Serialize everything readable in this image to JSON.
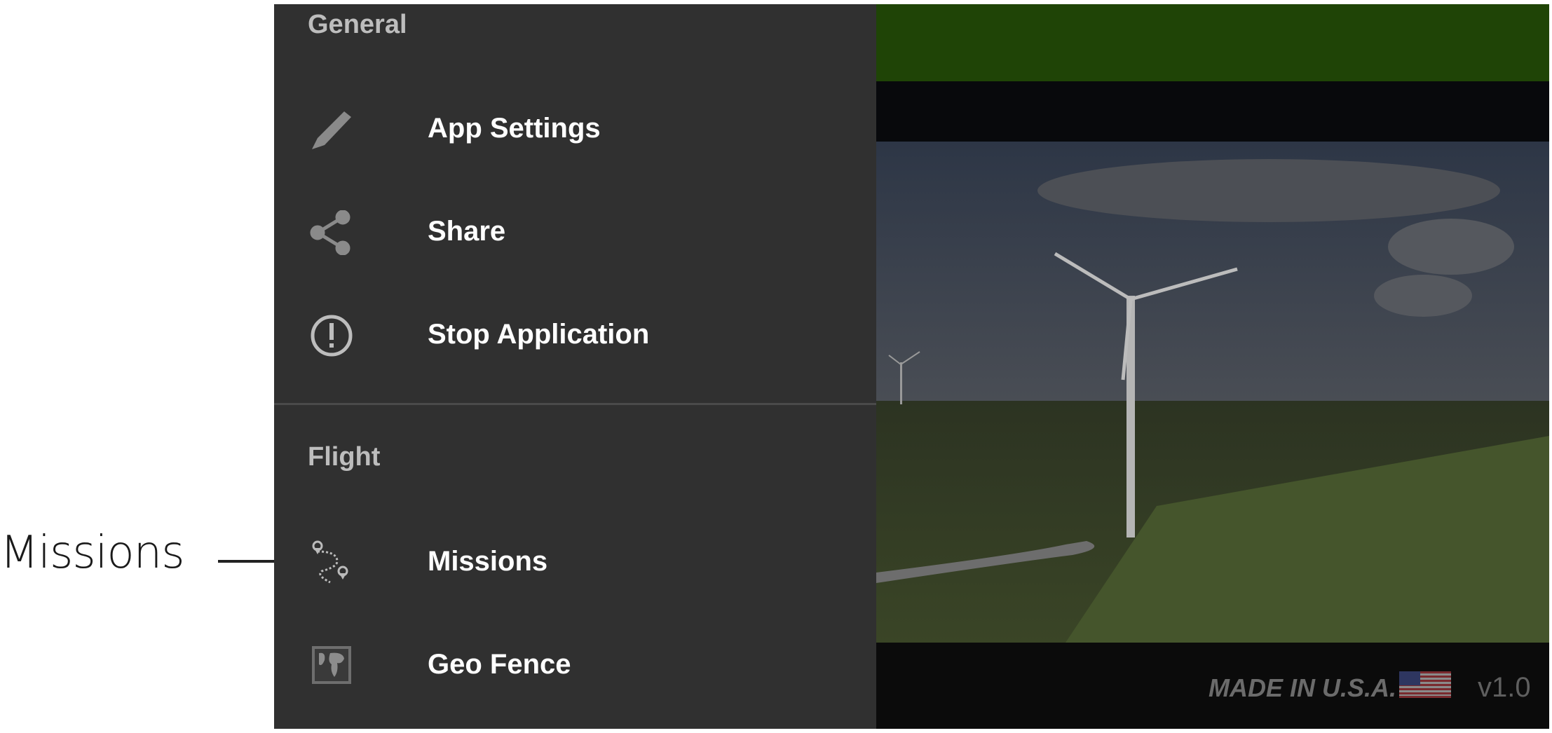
{
  "annotation": {
    "label": "Missions"
  },
  "drawer": {
    "sections": [
      {
        "title": "General",
        "items": [
          {
            "label": "App Settings",
            "icon": "pencil-icon"
          },
          {
            "label": "Share",
            "icon": "share-icon"
          },
          {
            "label": "Stop Application",
            "icon": "alert-circle-icon"
          }
        ]
      },
      {
        "title": "Flight",
        "items": [
          {
            "label": "Missions",
            "icon": "route-pins-icon"
          },
          {
            "label": "Geo Fence",
            "icon": "world-map-icon"
          }
        ]
      }
    ]
  },
  "background": {
    "made_in": "MADE IN U.S.A.",
    "version": "v1.0",
    "colors": {
      "header_green": "#1f4406",
      "drawer": "#303030"
    }
  }
}
